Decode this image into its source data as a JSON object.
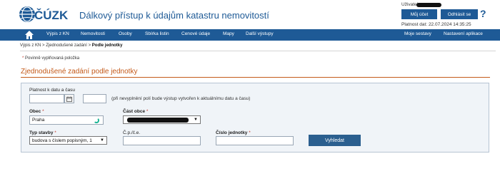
{
  "header": {
    "logo_text": "ČÚZK",
    "app_title": "Dálkový přístup k údajům katastru nemovitostí",
    "user_label": "Uživatel:",
    "account_button": "Můj účet",
    "logout_button": "Odhlásit se",
    "help_icon": "?",
    "data_validity": "Platnost dat: 22.07.2024 14:35:25"
  },
  "nav": {
    "home_icon": "home-icon",
    "items": [
      "Výpis z KN",
      "Nemovitosti",
      "Osoby",
      "Sbírka listin",
      "Cenové údaje",
      "Mapy",
      "Další výstupy"
    ],
    "right_items": [
      "Moje sestavy",
      "Nastavení aplikace"
    ]
  },
  "breadcrumb": {
    "items": [
      "Výpis z KN",
      "Zjednodušené zadání"
    ],
    "separator": ">",
    "current": "Podle jednotky"
  },
  "required_note": {
    "star": "*",
    "text": "Povinně vyplňovaná položka"
  },
  "page_title": "Zjednodušené zadání podle jednotky",
  "form": {
    "validity_label": "Platnost k datu a času",
    "date_value": "",
    "time_value": "",
    "validity_hint": "(při nevyplnění polí bude výstup vytvořen k aktuálnímu datu a času)",
    "obec_label": "Obec",
    "obec_value": "Praha",
    "cast_obce_label": "Část obce",
    "typ_stavby_label": "Typ stavby",
    "typ_stavby_value": "budova s číslem popisným, 1",
    "cp_ce_label": "Č.p./č.e.",
    "cp_ce_value": "",
    "cislo_jednotky_label": "Číslo jednotky",
    "cislo_jednotky_value": "",
    "search_button": "Vyhledat",
    "required_star": "*"
  },
  "colors": {
    "brand_blue": "#1e5a96",
    "title_orange": "#c45a1a",
    "required_red": "#c0392b"
  }
}
